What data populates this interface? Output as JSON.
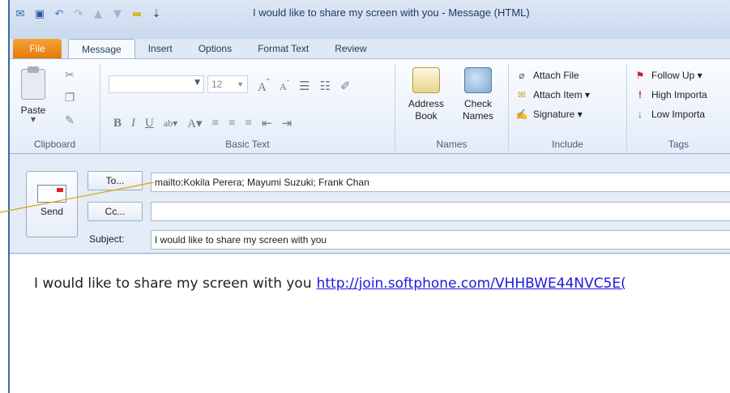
{
  "window": {
    "title": "I would like to share my screen with you  -  Message (HTML)"
  },
  "quick_access": [
    "outlook-icon",
    "save-icon",
    "undo-icon",
    "redo-icon",
    "up-icon",
    "down-icon",
    "folder-icon",
    "customize-icon"
  ],
  "tabs": [
    {
      "label": "File"
    },
    {
      "label": "Message"
    },
    {
      "label": "Insert"
    },
    {
      "label": "Options"
    },
    {
      "label": "Format Text"
    },
    {
      "label": "Review"
    }
  ],
  "ribbon": {
    "clipboard": {
      "label": "Clipboard",
      "paste": "Paste"
    },
    "basic_text": {
      "label": "Basic Text",
      "font_size": "12",
      "bold": "B",
      "italic": "I",
      "underline": "U"
    },
    "names": {
      "label": "Names",
      "address_book": "Address Book",
      "check_names": "Check Names"
    },
    "include": {
      "label": "Include",
      "attach_file": "Attach File",
      "attach_item": "Attach Item ▾",
      "signature": "Signature ▾"
    },
    "tags": {
      "label": "Tags",
      "follow_up": "Follow Up ▾",
      "high_importance": "High Importa",
      "low_importance": "Low Importa"
    }
  },
  "compose": {
    "send": "Send",
    "to_button": "To...",
    "cc_button": "Cc...",
    "subject_label": "Subject:",
    "to_value": "mailto:Kokila Perera; Mayumi Suzuki; Frank Chan",
    "cc_value": "",
    "subject_value": "I would like to share my screen with you"
  },
  "body": {
    "text": "I would like to share my screen with you",
    "link": "http://join.softphone.com/VHHBWE44NVC5E("
  },
  "colors": {
    "file_tab": "#e57a0c",
    "link": "#1a1adb",
    "leader_line": "#d9a400"
  }
}
